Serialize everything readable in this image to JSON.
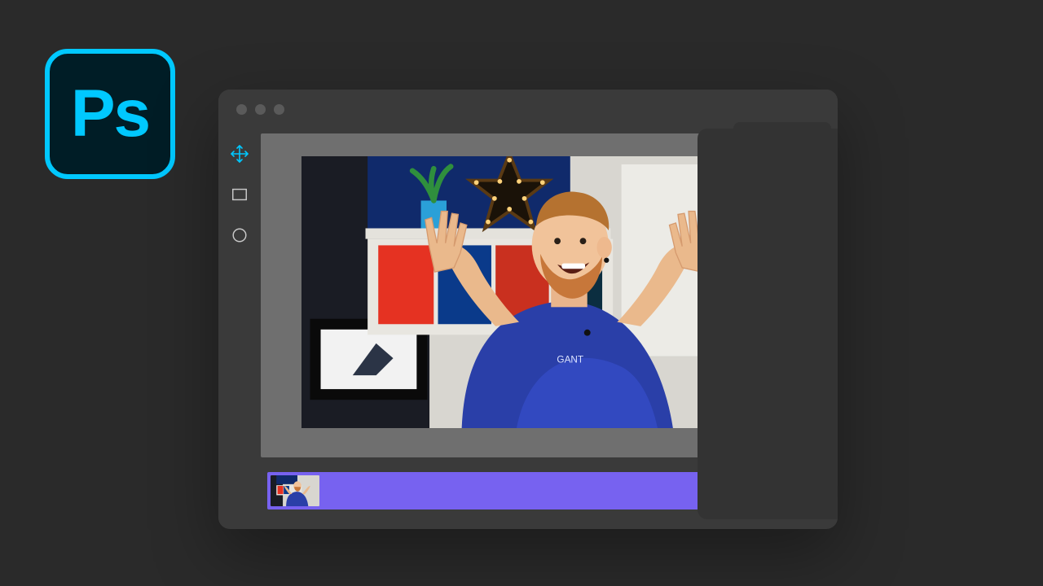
{
  "app_badge": {
    "label": "Ps"
  },
  "toolbar": {
    "tools": [
      {
        "name": "move-tool-icon",
        "active": true
      },
      {
        "name": "rectangle-tool-icon",
        "active": false
      },
      {
        "name": "ellipse-tool-icon",
        "active": false
      }
    ]
  },
  "colors": {
    "accent_cyan": "#00c8ff",
    "timeline_clip": "#7762f0",
    "window_bg": "#3a3a3a",
    "canvas_bg": "#6f6f6f"
  },
  "canvas": {
    "image_description": "Man with reddish beard in blue t-shirt, hands raised, in front of studio shelf with star light, plant, books and monitor"
  },
  "timeline": {
    "clip_label": ""
  }
}
